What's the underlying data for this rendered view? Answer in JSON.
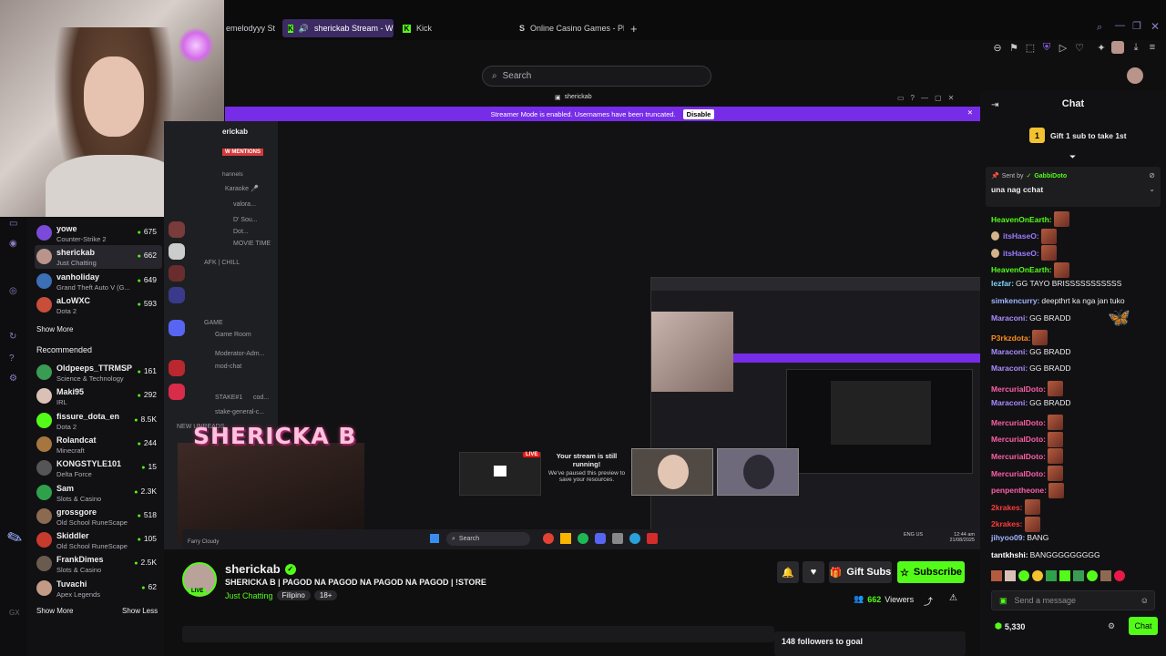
{
  "browser": {
    "tabs": [
      {
        "label": "emelodyyy St"
      },
      {
        "label": "sherickab Stream - W"
      },
      {
        "label": "Kick"
      },
      {
        "label": "Online Casino Games - Pl"
      }
    ]
  },
  "search": {
    "placeholder": "Search"
  },
  "sidebar": {
    "following": [
      {
        "name": "yowe",
        "category": "Counter-Strike 2",
        "viewers": "675",
        "color": "#7b4ad8"
      },
      {
        "name": "sherickab",
        "category": "Just Chatting",
        "viewers": "662",
        "color": "#b8948a"
      },
      {
        "name": "vanholiday",
        "category": "Grand Theft Auto V (G...",
        "viewers": "649",
        "color": "#3b6fb6"
      },
      {
        "name": "aLoWXC",
        "category": "Dota 2",
        "viewers": "593",
        "color": "#c84e3a"
      }
    ],
    "show_more": "Show More",
    "recommended_title": "Recommended",
    "recommended": [
      {
        "name": "Oldpeeps_TTRMSP",
        "category": "Science & Technology",
        "viewers": "161",
        "color": "#3a9b55"
      },
      {
        "name": "Maki95",
        "category": "IRL",
        "viewers": "292",
        "color": "#d9c1b5"
      },
      {
        "name": "fissure_dota_en",
        "category": "Dota 2",
        "viewers": "8.5K",
        "color": "#53fc18"
      },
      {
        "name": "Rolandcat",
        "category": "Minecraft",
        "viewers": "244",
        "color": "#a7763f"
      },
      {
        "name": "KONGSTYLE101",
        "category": "Delta Force",
        "viewers": "15",
        "color": "#555"
      },
      {
        "name": "Sam",
        "category": "Slots & Casino",
        "viewers": "2.3K",
        "color": "#2fa14a"
      },
      {
        "name": "grossgore",
        "category": "Old School RuneScape",
        "viewers": "518",
        "color": "#8c6a52"
      },
      {
        "name": "Skiddler",
        "category": "Old School RuneScape",
        "viewers": "105",
        "color": "#c73b2e"
      },
      {
        "name": "FrankDimes",
        "category": "Slots & Casino",
        "viewers": "2.5K",
        "color": "#6a5b4e"
      },
      {
        "name": "Tuvachi",
        "category": "Apex Legends",
        "viewers": "62",
        "color": "#c29a86"
      }
    ],
    "show_more_2": "Show More",
    "show_less": "Show Less"
  },
  "discord": {
    "server_name": "erickab",
    "mentions": "W MENTIONS",
    "channels_label": "hannels",
    "channels": [
      "Karaoke 🎤",
      "valora...",
      "D' Sou...",
      "Dot...",
      "MOVIE TIME",
      "AFK | CHILL",
      "GAME",
      "Game Room",
      "Moderator-Adm...",
      "mod-chat",
      "STAKE#1",
      "cod...",
      "stake-general-c...",
      "NEW UNREADS"
    ]
  },
  "player": {
    "window_title": "sherickab",
    "streamer_mode_text": "Streamer Mode is enabled. Usernames have been truncated.",
    "disable_label": "Disable",
    "overlay_title": "SHERICKA B",
    "paused_title": "Your stream is still running!",
    "paused_body": "We've paused this preview to save your resources.",
    "live_badge": "LIVE",
    "taskbar_search": "Search",
    "taskbar_lang": "ENG US",
    "taskbar_time": "12:44 am",
    "taskbar_date": "21/08/2025",
    "bottom_left_user": "Farry Cloudy"
  },
  "stream_info": {
    "channel": "sherickab",
    "title": "SHERICKA B | PAGOD NA PAGOD NA PAGOD NA PAGOD | !STORE",
    "category": "Just Chatting",
    "tags": [
      "Filipino",
      "18+"
    ],
    "live": "LIVE",
    "gift_subs": "Gift Subs",
    "subscribe": "Subscribe",
    "viewers_count": "662",
    "viewers_label": "Viewers",
    "followers_goal": "148 followers to goal"
  },
  "chat": {
    "title": "Chat",
    "gift_banner": "Gift 1 sub to take 1st",
    "gift_count": "1",
    "pinned_sent_by": "Sent by",
    "pinned_user": "GabbiDoto",
    "pinned_text": "una nag cchat",
    "messages": [
      {
        "user": "HeavenOnEarth:",
        "text": "",
        "emote": true,
        "color": "#53fc18",
        "egg": false
      },
      {
        "user": "itsHaseO:",
        "text": "",
        "emote": true,
        "color": "#9b7cff",
        "egg": true
      },
      {
        "user": "itsHaseO:",
        "text": "",
        "emote": true,
        "color": "#9b7cff",
        "egg": true
      },
      {
        "user": "HeavenOnEarth:",
        "text": "",
        "emote": true,
        "color": "#53fc18",
        "egg": false
      },
      {
        "user": "lezfar:",
        "text": "GG TAYO BRISSSSSSSSSSS",
        "emote": false,
        "color": "#7fd3ff",
        "egg": false
      },
      {
        "user": "simkencurry:",
        "text": "deepthrt ka nga jan tuko",
        "emote": false,
        "color": "#9fb6ff",
        "egg": false
      },
      {
        "user": "Maraconi:",
        "text": "GG BRADD",
        "emote": false,
        "color": "#a98cff",
        "egg": false
      },
      {
        "user": "P3rkzdota:",
        "text": "",
        "emote": true,
        "color": "#ff8c1a",
        "egg": false
      },
      {
        "user": "Maraconi:",
        "text": "GG BRADD",
        "emote": false,
        "color": "#a98cff",
        "egg": false
      },
      {
        "user": "Maraconi:",
        "text": "GG BRADD",
        "emote": false,
        "color": "#a98cff",
        "egg": false
      },
      {
        "user": "MercurialDoto:",
        "text": "",
        "emote": true,
        "color": "#ff5fa8",
        "egg": false
      },
      {
        "user": "Maraconi:",
        "text": "GG BRADD",
        "emote": false,
        "color": "#a98cff",
        "egg": false
      },
      {
        "user": "MercurialDoto:",
        "text": "",
        "emote": true,
        "color": "#ff5fa8",
        "egg": false
      },
      {
        "user": "MercurialDoto:",
        "text": "",
        "emote": true,
        "color": "#ff5fa8",
        "egg": false
      },
      {
        "user": "MercurialDoto:",
        "text": "",
        "emote": true,
        "color": "#ff5fa8",
        "egg": false
      },
      {
        "user": "MercurialDoto:",
        "text": "",
        "emote": true,
        "color": "#ff5fa8",
        "egg": false
      },
      {
        "user": "penpentheone:",
        "text": "",
        "emote": true,
        "color": "#ff5fa8",
        "egg": false
      },
      {
        "user": "2krakes:",
        "text": "",
        "emote": true,
        "color": "#ff3b3b",
        "egg": false
      },
      {
        "user": "2krakes:",
        "text": "",
        "emote": true,
        "color": "#ff3b3b",
        "egg": false
      },
      {
        "user": "jihyoo09:",
        "text": "BANG",
        "emote": false,
        "color": "#9fb6ff",
        "egg": false
      },
      {
        "user": "tantkhshi:",
        "text": "BANGGGGGGGGG",
        "emote": false,
        "color": "#ffffff",
        "egg": false
      }
    ],
    "input_placeholder": "Send a message",
    "points": "5,330",
    "send_label": "Chat"
  },
  "colors": {
    "kick_green": "#53fc18",
    "streamer_purple": "#772ce8"
  }
}
